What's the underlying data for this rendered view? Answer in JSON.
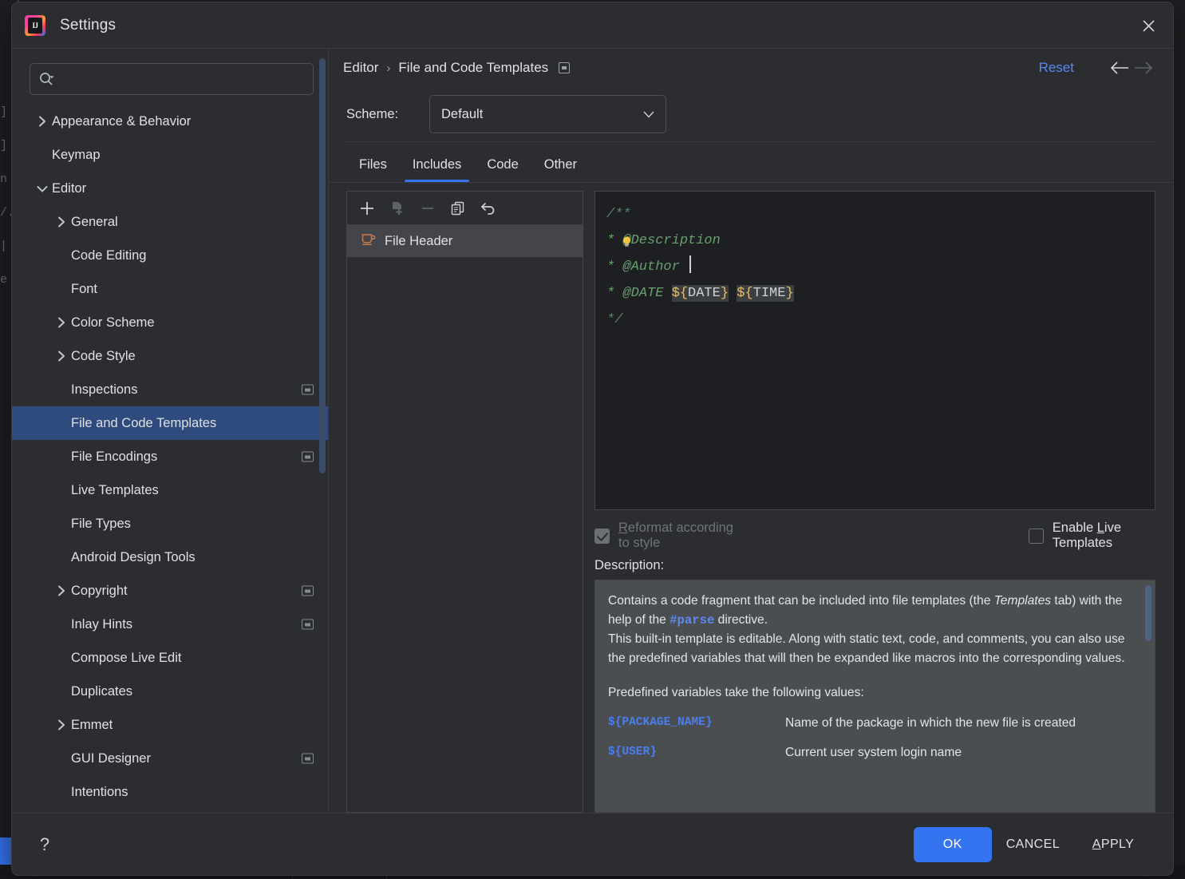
{
  "background": {
    "editor_fragments": "]\n]\nn\n/.i\n| |\ne"
  },
  "titlebar": {
    "app_icon": "intellij-idea-logo",
    "logo_text": "IJ",
    "title": "Settings",
    "close_icon": "close-icon"
  },
  "search": {
    "icon": "search-icon",
    "value": "",
    "placeholder": ""
  },
  "sidebar": {
    "items": [
      {
        "label": "Appearance & Behavior",
        "depth": 0,
        "arrow": "right",
        "badge": false,
        "selected": false
      },
      {
        "label": "Keymap",
        "depth": 0,
        "arrow": "none",
        "badge": false,
        "selected": false
      },
      {
        "label": "Editor",
        "depth": 0,
        "arrow": "down",
        "badge": false,
        "selected": false
      },
      {
        "label": "General",
        "depth": 1,
        "arrow": "right",
        "badge": false,
        "selected": false
      },
      {
        "label": "Code Editing",
        "depth": 1,
        "arrow": "none",
        "badge": false,
        "selected": false
      },
      {
        "label": "Font",
        "depth": 1,
        "arrow": "none",
        "badge": false,
        "selected": false
      },
      {
        "label": "Color Scheme",
        "depth": 1,
        "arrow": "right",
        "badge": false,
        "selected": false
      },
      {
        "label": "Code Style",
        "depth": 1,
        "arrow": "right",
        "badge": false,
        "selected": false
      },
      {
        "label": "Inspections",
        "depth": 1,
        "arrow": "none",
        "badge": true,
        "selected": false
      },
      {
        "label": "File and Code Templates",
        "depth": 1,
        "arrow": "none",
        "badge": false,
        "selected": true
      },
      {
        "label": "File Encodings",
        "depth": 1,
        "arrow": "none",
        "badge": true,
        "selected": false
      },
      {
        "label": "Live Templates",
        "depth": 1,
        "arrow": "none",
        "badge": false,
        "selected": false
      },
      {
        "label": "File Types",
        "depth": 1,
        "arrow": "none",
        "badge": false,
        "selected": false
      },
      {
        "label": "Android Design Tools",
        "depth": 1,
        "arrow": "none",
        "badge": false,
        "selected": false
      },
      {
        "label": "Copyright",
        "depth": 1,
        "arrow": "right",
        "badge": true,
        "selected": false
      },
      {
        "label": "Inlay Hints",
        "depth": 1,
        "arrow": "none",
        "badge": true,
        "selected": false
      },
      {
        "label": "Compose Live Edit",
        "depth": 1,
        "arrow": "none",
        "badge": false,
        "selected": false
      },
      {
        "label": "Duplicates",
        "depth": 1,
        "arrow": "none",
        "badge": false,
        "selected": false
      },
      {
        "label": "Emmet",
        "depth": 1,
        "arrow": "right",
        "badge": false,
        "selected": false
      },
      {
        "label": "GUI Designer",
        "depth": 1,
        "arrow": "none",
        "badge": true,
        "selected": false
      },
      {
        "label": "Intentions",
        "depth": 1,
        "arrow": "none",
        "badge": false,
        "selected": false
      }
    ]
  },
  "breadcrumb": {
    "parent": "Editor",
    "separator": "›",
    "current": "File and Code Templates",
    "edit_icon": "settings-window-icon",
    "reset_label": "Reset",
    "back_icon": "arrow-left-icon",
    "forward_icon": "arrow-right-icon"
  },
  "scheme": {
    "label": "Scheme:",
    "value": "Default",
    "chevron": "chevron-down-icon"
  },
  "tabs": [
    {
      "label": "Files",
      "active": false
    },
    {
      "label": "Includes",
      "active": true
    },
    {
      "label": "Code",
      "active": false
    },
    {
      "label": "Other",
      "active": false
    }
  ],
  "template_toolbar": [
    {
      "name": "add-icon",
      "enabled": true
    },
    {
      "name": "copy-template-icon",
      "enabled": false
    },
    {
      "name": "remove-icon",
      "enabled": false
    },
    {
      "name": "duplicate-icon",
      "enabled": true
    },
    {
      "name": "revert-icon",
      "enabled": true
    }
  ],
  "template_list": [
    {
      "label": "File Header",
      "icon": "java-coffee-cup-icon",
      "selected": true
    }
  ],
  "editor": {
    "lines": [
      {
        "text": "/**",
        "kind": "comment"
      },
      {
        "text": "* @Description",
        "kind": "tag",
        "bulb": true
      },
      {
        "text": "* @Author ",
        "kind": "tag",
        "caret": true
      },
      {
        "text": "* @DATE ",
        "kind": "tag",
        "vars": [
          "${DATE}",
          "${TIME}"
        ]
      },
      {
        "text": "*/",
        "kind": "comment"
      }
    ]
  },
  "options": {
    "reformat": {
      "label": "Reformat according to style",
      "checked": true,
      "disabled": true,
      "mnemonic": "R"
    },
    "live_templates": {
      "label": "Enable Live Templates",
      "checked": false,
      "disabled": false,
      "mnemonic": "L"
    }
  },
  "description": {
    "label": "Description:",
    "p1_a": "Contains a code fragment that can be included into file templates (the ",
    "p1_em": "Templates",
    "p1_b": " tab) with the help of the ",
    "p1_code": "#parse",
    "p1_c": " directive.",
    "p2": "This built-in template is editable. Along with static text, code, and comments, you can also use the predefined variables that will then be expanded like macros into the corresponding values.",
    "vars_intro": "Predefined variables take the following values:",
    "vars": [
      {
        "name": "${PACKAGE_NAME}",
        "desc": "Name of the package in which the new file is created"
      },
      {
        "name": "${USER}",
        "desc": "Current user system login name"
      }
    ]
  },
  "footer": {
    "help_icon": "help-question-icon",
    "ok": "OK",
    "cancel": "CANCEL",
    "apply_prefix": "A",
    "apply_rest": "PPLY"
  },
  "colors": {
    "accent": "#3574f0",
    "link": "#548af7",
    "selection": "#2f4a7c",
    "dialog_bg": "#2b2d30",
    "editor_bg": "#1e1f22",
    "desc_bg": "#4b4e51",
    "comment_green": "#5f826b",
    "var_yellow": "#e8bf6a",
    "java_orange": "#c97a46"
  }
}
